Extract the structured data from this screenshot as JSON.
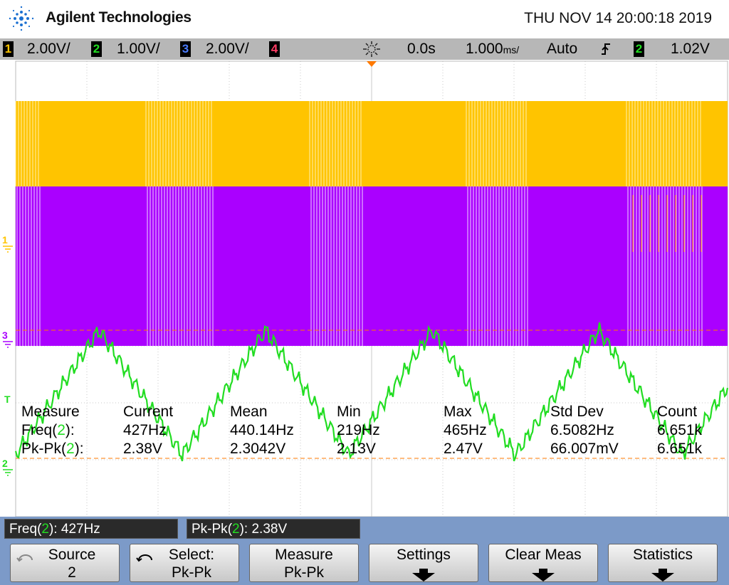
{
  "header": {
    "brand": "Agilent Technologies",
    "datetime": "THU NOV 14 20:00:18 2019",
    "logo_icon": "agilent-spark-icon"
  },
  "statusbar": {
    "channels": [
      {
        "num": "1",
        "scale": "2.00V/",
        "color": "#ffc400"
      },
      {
        "num": "2",
        "scale": "1.00V/",
        "color": "#22dd22"
      },
      {
        "num": "3",
        "scale": "2.00V/",
        "color": "#4a7cff"
      },
      {
        "num": "4",
        "scale": "",
        "color": "#ff3c64"
      }
    ],
    "trigger_icon": "trigger-indicator-icon",
    "delay": "0.0s",
    "timebase": "1.000",
    "timebase_unit": "ms/",
    "mode": "Auto",
    "trigger_edge_icon": "rising-edge-icon",
    "trigger_source": "2",
    "trigger_level": "1.02V"
  },
  "screen": {
    "markers": {
      "ch1": "1",
      "ch3": "3",
      "ch2": "2",
      "trigger": "T"
    },
    "colors": {
      "ch1": "#ffc400",
      "ch2": "#22dd22",
      "ch3": "#aa00ff",
      "orange": "#ff7a00"
    }
  },
  "measure": {
    "headers": [
      "Measure",
      "Current",
      "Mean",
      "Min",
      "Max",
      "Std Dev",
      "Count"
    ],
    "rows": [
      {
        "name": "Freq",
        "ch": "2",
        "values": [
          "427Hz",
          "440.14Hz",
          "219Hz",
          "465Hz",
          "6.5082Hz",
          "6.651k"
        ]
      },
      {
        "name": "Pk-Pk",
        "ch": "2",
        "values": [
          "2.38V",
          "2.3042V",
          "2.13V",
          "2.47V",
          "66.007mV",
          "6.651k"
        ]
      }
    ]
  },
  "readouts": [
    {
      "name": "Freq",
      "ch": "2",
      "value": "427Hz"
    },
    {
      "name": "Pk-Pk",
      "ch": "2",
      "value": "2.38V"
    }
  ],
  "softkeys": [
    {
      "l1": "Source",
      "l2": "2"
    },
    {
      "l1": "Select:",
      "l2": "Pk-Pk"
    },
    {
      "l1": "Measure",
      "l2": "Pk-Pk"
    },
    {
      "l1": "Settings",
      "l2": ""
    },
    {
      "l1": "Clear Meas",
      "l2": ""
    },
    {
      "l1": "Statistics",
      "l2": ""
    }
  ]
}
